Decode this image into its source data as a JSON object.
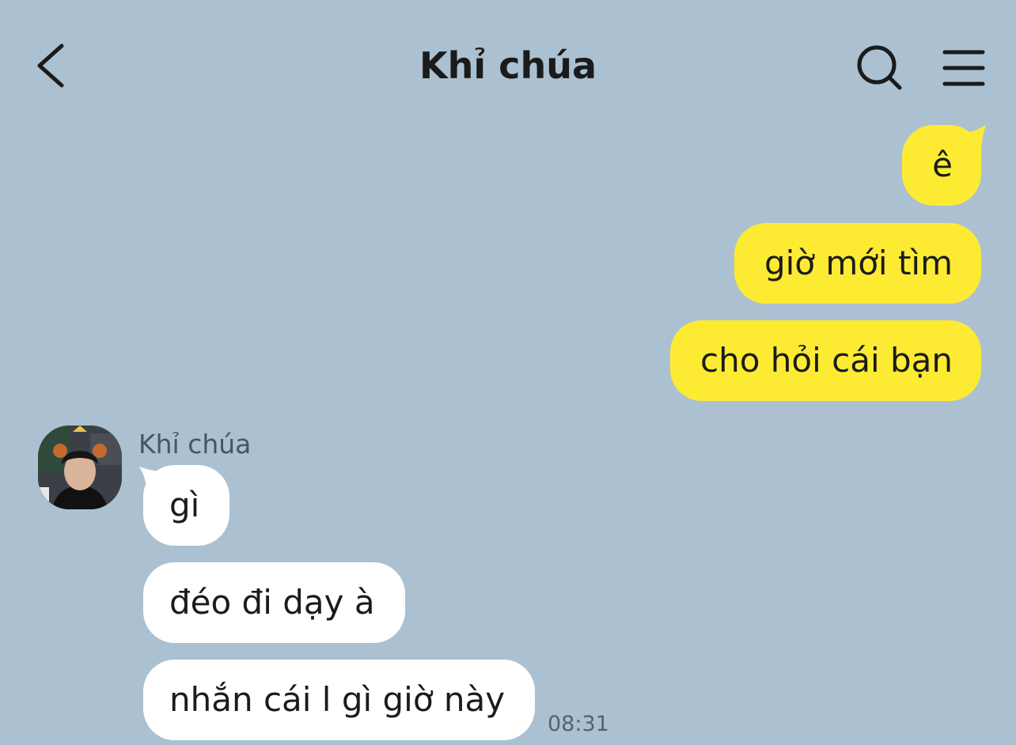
{
  "header": {
    "title": "Khỉ chúa",
    "back_icon": "chevron-left-icon",
    "search_icon": "search-icon",
    "menu_icon": "hamburger-menu-icon"
  },
  "colors": {
    "background": "#abc1d1",
    "outgoing_bubble": "#fdeb33",
    "incoming_bubble": "#ffffff"
  },
  "outgoing": [
    {
      "text": "ê"
    },
    {
      "text": "giờ mới tìm"
    },
    {
      "text": "cho hỏi cái bạn"
    }
  ],
  "incoming": {
    "sender": "Khỉ chúa",
    "messages": [
      {
        "text": "gì"
      },
      {
        "text": "đéo đi dạy à"
      },
      {
        "text": "nhắn cái l gì giờ này"
      }
    ],
    "time": "08:31"
  }
}
